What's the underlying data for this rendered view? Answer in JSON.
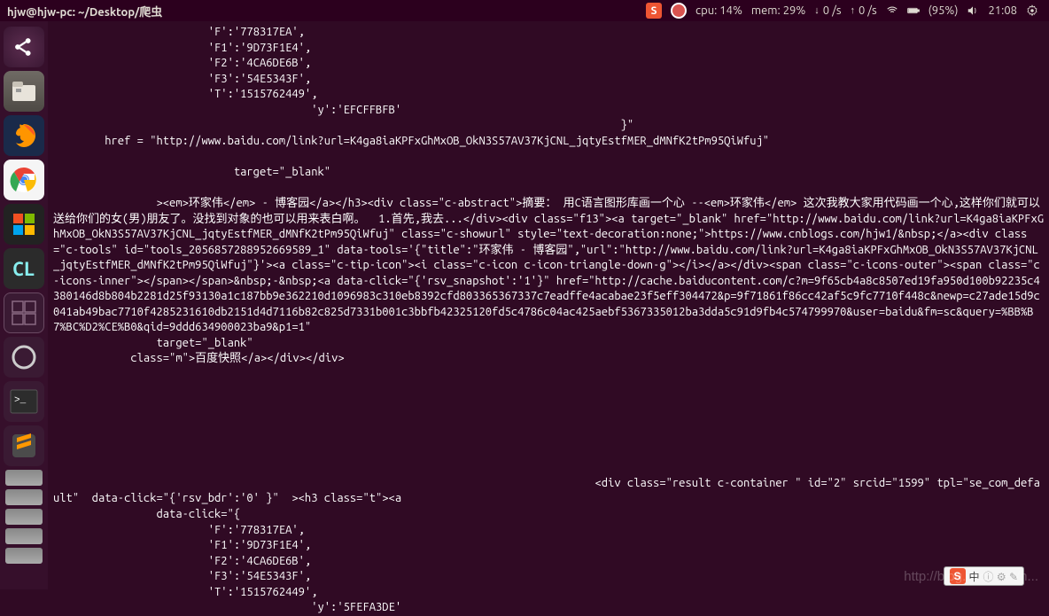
{
  "topbar": {
    "title": "hjw@hjw-pc: ~/Desktop/爬虫",
    "cpu": "cpu: 14%",
    "mem": "mem: 29%",
    "down": "0 /s",
    "up": "0 /s",
    "battery": "(95%)",
    "time": "21:08"
  },
  "launcher": {
    "dash": "⌂",
    "clion": "CL"
  },
  "terminal": {
    "lines": [
      "                        'F':'778317EA',",
      "                        'F1':'9D73F1E4',",
      "                        'F2':'4CA6DE6B',",
      "                        'F3':'54E5343F',",
      "                        'T':'1515762449',",
      "                                        'y':'EFCFFBFB'",
      "                                                                                        }\"",
      "        href = \"http://www.baidu.com/link?url=K4ga8iaKPFxGhMxOB_OkN3S57AV37KjCNL_jqtyEstfMER_dMNfK2tPm95QiWfuj\"",
      "",
      "                            target=\"_blank\"",
      "",
      "                ><em>环家伟</em> - 博客园</a></h3><div class=\"c-abstract\">摘要： 用C语言图形库画一个心 --<em>环家伟</em> 这次我教大家用代码画一个心,这样你们就可以送给你们的女(男)朋友了。没找到对象的也可以用来表白啊。  1.首先,我去...</div><div class=\"f13\"><a target=\"_blank\" href=\"http://www.baidu.com/link?url=K4ga8iaKPFxGhMxOB_OkN3S57AV37KjCNL_jqtyEstfMER_dMNfK2tPm95QiWfuj\" class=\"c-showurl\" style=\"text-decoration:none;\">https://www.cnblogs.com/hjw1/&nbsp;</a><div class=\"c-tools\" id=\"tools_2056857288952669589_1\" data-tools='{\"title\":\"环家伟 - 博客园\",\"url\":\"http://www.baidu.com/link?url=K4ga8iaKPFxGhMxOB_OkN3S57AV37KjCNL_jqtyEstfMER_dMNfK2tPm95QiWfuj\"}'><a class=\"c-tip-icon\"><i class=\"c-icon c-icon-triangle-down-g\"></i></a></div><span class=\"c-icons-outer\"><span class=\"c-icons-inner\"></span></span>&nbsp;-&nbsp;<a data-click=\"{'rsv_snapshot':'1'}\" href=\"http://cache.baiducontent.com/c?m=9f65cb4a8c8507ed19fa950d100b92235c4380146d8b804b2281d25f93130a1c187bb9e362210d1096983c310eb8392cfd803365367337c7eadffe4acabae23f5eff304472&p=9f71861f86cc42af5c9fc7710f448c&newp=c27ade15d9c041ab49bac7710f4285231610db2151d4d7116b82c825d7331b001c3bbfb42325120fd5c4786c04ac425aebf5367335012ba3dda5c91d9fb4c574799970&user=baidu&fm=sc&query=%BB%B7%BC%D2%CE%B0&qid=9ddd634900023ba9&p1=1\"",
      "                target=\"_blank\"",
      "            class=\"m\">百度快照</a></div></div>",
      "",
      "",
      "",
      "",
      "",
      "",
      "",
      "                                                                                    <div class=\"result c-container \" id=\"2\" srcid=\"1599\" tpl=\"se_com_default\"  data-click=\"{'rsv_bdr':'0' }\"  ><h3 class=\"t\"><a",
      "                data-click=\"{",
      "                        'F':'778317EA',",
      "                        'F1':'9D73F1E4',",
      "                        'F2':'4CA6DE6B',",
      "                        'F3':'54E5343F',",
      "                        'T':'1515762449',",
      "                                        'y':'5FEFA3DE'"
    ]
  },
  "watermark": "http://blog.csdn.net/h...",
  "ime": {
    "label": "中",
    "extra": "S"
  }
}
